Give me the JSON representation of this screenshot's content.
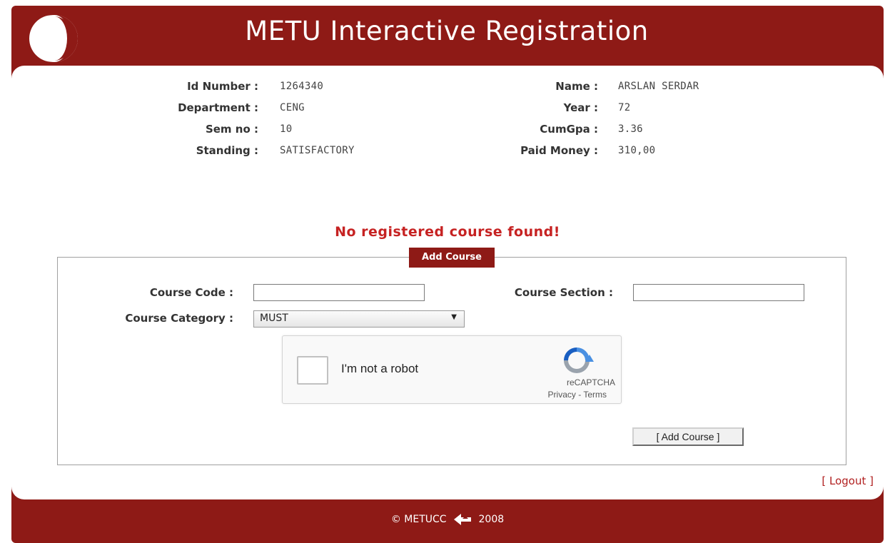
{
  "header": {
    "title": "METU Interactive Registration",
    "logo_icon": "metu-logo-icon"
  },
  "student": {
    "left": [
      {
        "label": "Id Number :",
        "value": "1264340"
      },
      {
        "label": "Department :",
        "value": "CENG"
      },
      {
        "label": "Sem no :",
        "value": "10"
      },
      {
        "label": "Standing :",
        "value": "SATISFACTORY"
      }
    ],
    "right": [
      {
        "label": "Name :",
        "value": "ARSLAN SERDAR"
      },
      {
        "label": "Year :",
        "value": "72"
      },
      {
        "label": "CumGpa :",
        "value": "3.36"
      },
      {
        "label": "Paid Money :",
        "value": "310,00"
      }
    ]
  },
  "status_message": "No registered course found!",
  "add_course": {
    "legend": "Add Course",
    "course_code_label": "Course Code :",
    "course_code_value": "",
    "course_section_label": "Course Section :",
    "course_section_value": "",
    "course_category_label": "Course Category :",
    "course_category_selected": "MUST",
    "captcha": {
      "checkbox_text": "I'm not a robot",
      "brand": "reCAPTCHA",
      "links": "Privacy - Terms"
    },
    "submit_label": "[ Add Course ]"
  },
  "logout_label": "[ Logout ]",
  "footer": {
    "left_text": "© METUCC",
    "right_text": "2008"
  },
  "colors": {
    "brand": "#8e1a16",
    "error": "#c62222",
    "link": "#b12020"
  }
}
